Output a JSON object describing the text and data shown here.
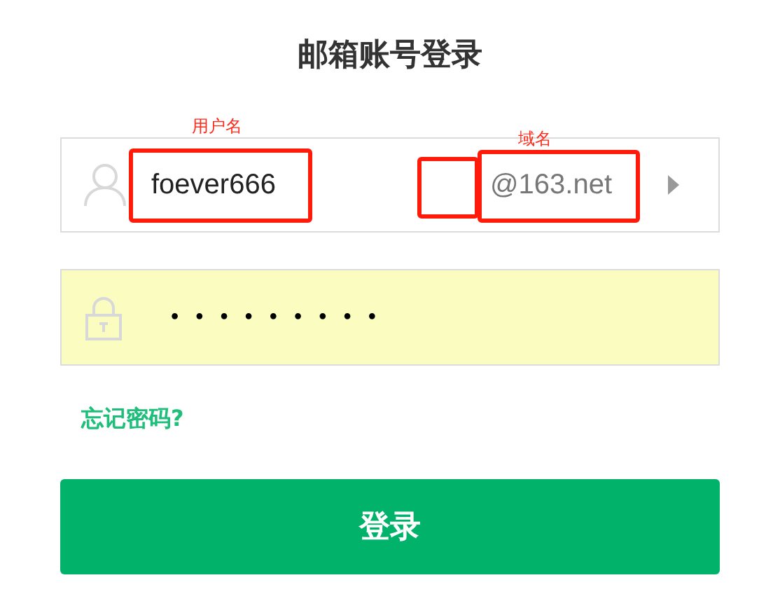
{
  "title": "邮箱账号登录",
  "username": {
    "value": "foever666",
    "domain": "@163.net"
  },
  "password": {
    "value": "•••••••••",
    "autofilled": true
  },
  "forgot_link": "忘记密码?",
  "login_button": "登录",
  "annotations": [
    {
      "label": "用户名"
    },
    {
      "label": "域名"
    }
  ]
}
